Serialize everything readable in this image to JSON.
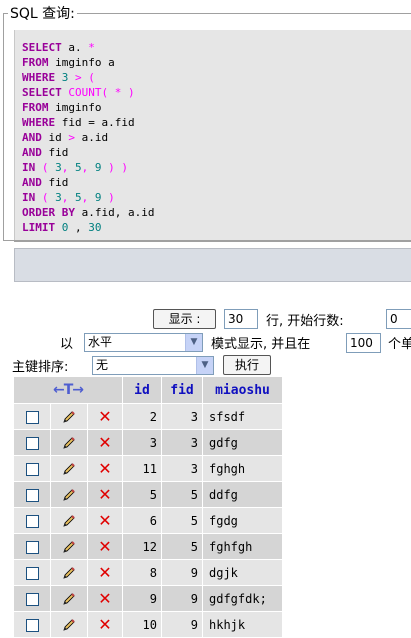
{
  "sql": {
    "legend": "SQL 查询:",
    "lines": [
      [
        [
          "kw",
          "SELECT"
        ],
        [
          "id",
          " a. "
        ],
        [
          "pn",
          "*"
        ]
      ],
      [
        [
          "kw",
          "FROM"
        ],
        [
          "id",
          " imginfo a"
        ]
      ],
      [
        [
          "kw",
          "WHERE"
        ],
        [
          "id",
          " "
        ],
        [
          "nm",
          "3"
        ],
        [
          "id",
          " "
        ],
        [
          "pn",
          ">"
        ],
        [
          "id",
          " "
        ],
        [
          "pn",
          "("
        ]
      ],
      [
        [
          "kw",
          "SELECT"
        ],
        [
          "id",
          " "
        ],
        [
          "fn",
          "COUNT"
        ],
        [
          "pn",
          "("
        ],
        [
          "id",
          " "
        ],
        [
          "pn",
          "*"
        ],
        [
          "id",
          " "
        ],
        [
          "pn",
          ")"
        ]
      ],
      [
        [
          "kw",
          "FROM"
        ],
        [
          "id",
          " imginfo"
        ]
      ],
      [
        [
          "kw",
          "WHERE"
        ],
        [
          "id",
          " fid = a.fid"
        ]
      ],
      [
        [
          "kw",
          "AND"
        ],
        [
          "id",
          " id "
        ],
        [
          "pn",
          ">"
        ],
        [
          "id",
          " a.id"
        ]
      ],
      [
        [
          "kw",
          "AND"
        ],
        [
          "id",
          " fid"
        ]
      ],
      [
        [
          "kw",
          "IN"
        ],
        [
          "id",
          " "
        ],
        [
          "pn",
          "("
        ],
        [
          "id",
          " "
        ],
        [
          "nm",
          "3"
        ],
        [
          "pn",
          ","
        ],
        [
          "id",
          " "
        ],
        [
          "nm",
          "5"
        ],
        [
          "pn",
          ","
        ],
        [
          "id",
          " "
        ],
        [
          "nm",
          "9"
        ],
        [
          "id",
          " "
        ],
        [
          "pn",
          ")"
        ],
        [
          "id",
          " "
        ],
        [
          "pn",
          ")"
        ]
      ],
      [
        [
          "kw",
          "AND"
        ],
        [
          "id",
          " fid"
        ]
      ],
      [
        [
          "kw",
          "IN"
        ],
        [
          "id",
          " "
        ],
        [
          "pn",
          "("
        ],
        [
          "id",
          " "
        ],
        [
          "nm",
          "3"
        ],
        [
          "pn",
          ","
        ],
        [
          "id",
          " "
        ],
        [
          "nm",
          "5"
        ],
        [
          "pn",
          ","
        ],
        [
          "id",
          " "
        ],
        [
          "nm",
          "9"
        ],
        [
          "id",
          " "
        ],
        [
          "pn",
          ")"
        ]
      ],
      [
        [
          "kw",
          "ORDER BY"
        ],
        [
          "id",
          " a.fid, a.id"
        ]
      ],
      [
        [
          "kw",
          "LIMIT"
        ],
        [
          "id",
          " "
        ],
        [
          "nm",
          "0"
        ],
        [
          "id",
          " , "
        ],
        [
          "nm",
          "30"
        ]
      ]
    ]
  },
  "nav": {
    "show_button": "显示 :",
    "rows_value": "30",
    "rows_label": "行, 开始行数:",
    "start_value": "0",
    "mode_prefix": "以",
    "mode_select": "水平",
    "mode_suffix": "模式显示, 并且在",
    "repeat_value": "100",
    "repeat_suffix": "个单",
    "sort_label": "主键排序:",
    "sort_select": "无",
    "exec_button": "执行"
  },
  "table": {
    "header_arrows": "←T→",
    "columns": [
      "id",
      "fid",
      "miaoshu"
    ],
    "rows": [
      {
        "id": "2",
        "fid": "3",
        "miaoshu": "sfsdf"
      },
      {
        "id": "3",
        "fid": "3",
        "miaoshu": "gdfg"
      },
      {
        "id": "11",
        "fid": "3",
        "miaoshu": "fghgh"
      },
      {
        "id": "5",
        "fid": "5",
        "miaoshu": "ddfg"
      },
      {
        "id": "6",
        "fid": "5",
        "miaoshu": "fgdg"
      },
      {
        "id": "12",
        "fid": "5",
        "miaoshu": "fghfgh"
      },
      {
        "id": "8",
        "fid": "9",
        "miaoshu": "dgjk"
      },
      {
        "id": "9",
        "fid": "9",
        "miaoshu": "gdfgfdk;"
      },
      {
        "id": "10",
        "fid": "9",
        "miaoshu": "hkhjk"
      }
    ]
  },
  "icons": {
    "edit": "pencil-icon",
    "delete": "delete-x-icon",
    "checkbox": "row-checkbox"
  },
  "colors": {
    "keyword": "#990099",
    "operator": "#ff00ff",
    "number": "#008080",
    "header_text": "#1010c0",
    "row_even": "#e5e5e5",
    "row_odd": "#d5d5d5",
    "delete": "#e00000"
  }
}
